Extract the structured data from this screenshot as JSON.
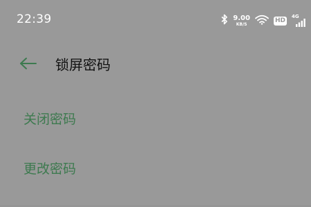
{
  "status_bar": {
    "time": "22:39",
    "net_speed_value": "9.00",
    "net_speed_unit": "KB/S",
    "hd_label": "HD",
    "network_type": "4G",
    "icons": [
      "bluetooth-icon",
      "wifi-icon",
      "hd-icon",
      "cellular-signal-icon"
    ]
  },
  "header": {
    "back_icon": "arrow-left-icon",
    "title": "锁屏密码"
  },
  "menu": {
    "items": [
      {
        "label": "关闭密码"
      },
      {
        "label": "更改密码"
      }
    ]
  },
  "colors": {
    "background": "#999999",
    "accent": "#3d7a4f",
    "title_text": "#111111",
    "status_text": "#ffffff"
  }
}
